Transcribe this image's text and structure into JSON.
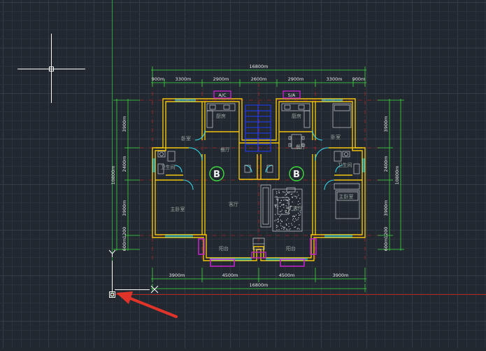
{
  "app": {
    "name": "CAD drawing viewport"
  },
  "colors": {
    "background": "#212830",
    "grid_minor": "#2b323c",
    "grid_major": "#343c47",
    "axis_y": "#2f9e44",
    "axis_x": "#b3261e",
    "dimension": "#3fdc3f",
    "wall": "#f2c40a",
    "window": "#33d6e8",
    "fixture": "#e8e8e8",
    "stair": "#1e3cff",
    "tag": "#c020c8",
    "axis_mark": "#e02020",
    "room_text": "#9aa6a0",
    "arrow": "#e0342a"
  },
  "drawing": {
    "overall_dimension": "16800m",
    "top_dimensions": [
      "900m",
      "3300m",
      "2900m",
      "2600m",
      "2900m",
      "3300m",
      "900m"
    ],
    "bottom_dimensions": [
      "3900m",
      "4500m",
      "4500m",
      "3900m"
    ],
    "left_dimensions": [
      "3900m",
      "2400m",
      "3900m",
      "1200",
      "600m"
    ],
    "left_total": "10800m",
    "right_dimensions": [
      "3900m",
      "2400m",
      "3900m",
      "1200",
      "600m"
    ],
    "right_total": "10800m",
    "unit_tags": [
      "A/C",
      "S/A"
    ],
    "axis_labels": [
      "B",
      "B"
    ],
    "rooms": {
      "kitchen": "厨房",
      "dining": "餐厅",
      "secondary_bedroom": "卧室",
      "bathroom": "卫生间",
      "master_bedroom": "主卧室",
      "living": "客厅",
      "balcony": "阳台"
    }
  },
  "ucs": {
    "x_label": "X",
    "y_label": "Y"
  }
}
